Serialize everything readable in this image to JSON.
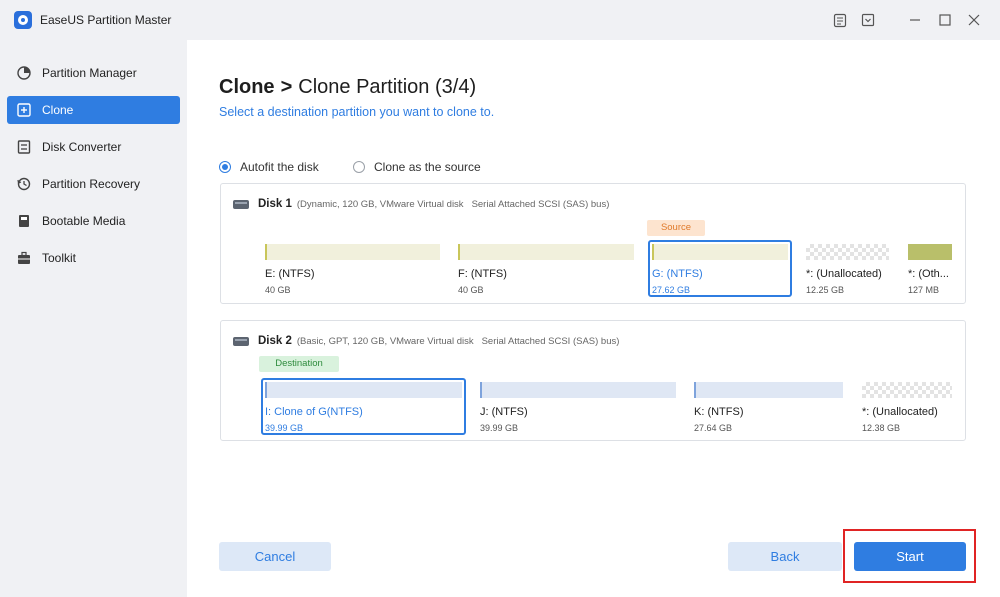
{
  "window": {
    "title": "EaseUS Partition Master",
    "controls": [
      "notes-icon",
      "dropdown-icon",
      "minimize-icon",
      "maximize-icon",
      "close-icon"
    ]
  },
  "sidebar": {
    "items": [
      {
        "label": "Partition Manager",
        "icon": "pie-chart-icon",
        "active": false
      },
      {
        "label": "Clone",
        "icon": "clone-icon",
        "active": true
      },
      {
        "label": "Disk Converter",
        "icon": "disk-converter-icon",
        "active": false
      },
      {
        "label": "Partition Recovery",
        "icon": "recovery-icon",
        "active": false
      },
      {
        "label": "Bootable Media",
        "icon": "bootable-media-icon",
        "active": false
      },
      {
        "label": "Toolkit",
        "icon": "toolkit-icon",
        "active": false
      }
    ]
  },
  "main": {
    "breadcrumb_root": "Clone",
    "breadcrumb_separator": ">",
    "breadcrumb_page": "Clone Partition (3/4)",
    "subtitle": "Select a destination partition you want to clone to.",
    "options": [
      {
        "label": "Autofit the disk",
        "checked": true
      },
      {
        "label": "Clone as the source",
        "checked": false
      }
    ],
    "disk1": {
      "name": "Disk 1",
      "details": "(Dynamic, 120 GB, VMware   Virtual disk",
      "bus": "Serial Attached SCSI (SAS) bus)",
      "tag": "Source",
      "partitions": [
        {
          "name": "E: (NTFS)",
          "size": "40 GB",
          "style": "olive",
          "selected": false
        },
        {
          "name": "F: (NTFS)",
          "size": "40 GB",
          "style": "olive",
          "selected": false
        },
        {
          "name": "G: (NTFS)",
          "size": "27.62 GB",
          "style": "olive",
          "selected": true
        },
        {
          "name": "*: (Unallocated)",
          "size": "12.25 GB",
          "style": "unallocated",
          "selected": false
        },
        {
          "name": "*: (Oth...",
          "size": "127 MB",
          "style": "green",
          "selected": false
        }
      ]
    },
    "disk2": {
      "name": "Disk 2",
      "details": "(Basic, GPT, 120 GB, VMware   Virtual disk",
      "bus": "Serial Attached SCSI (SAS) bus)",
      "tag": "Destination",
      "partitions": [
        {
          "name": "I: Clone of G(NTFS)",
          "size": "39.99 GB",
          "style": "blue",
          "selected": true
        },
        {
          "name": "J: (NTFS)",
          "size": "39.99 GB",
          "style": "blue",
          "selected": false
        },
        {
          "name": "K: (NTFS)",
          "size": "27.64 GB",
          "style": "blue",
          "selected": false
        },
        {
          "name": "*: (Unallocated)",
          "size": "12.38 GB",
          "style": "unallocated",
          "selected": false
        }
      ]
    },
    "buttons": {
      "cancel": "Cancel",
      "back": "Back",
      "start": "Start"
    }
  },
  "colors": {
    "accent": "#2f7de1",
    "source_tag": "#e07a2b",
    "destination_tag": "#2e8b3d",
    "highlight": "#e02424"
  }
}
